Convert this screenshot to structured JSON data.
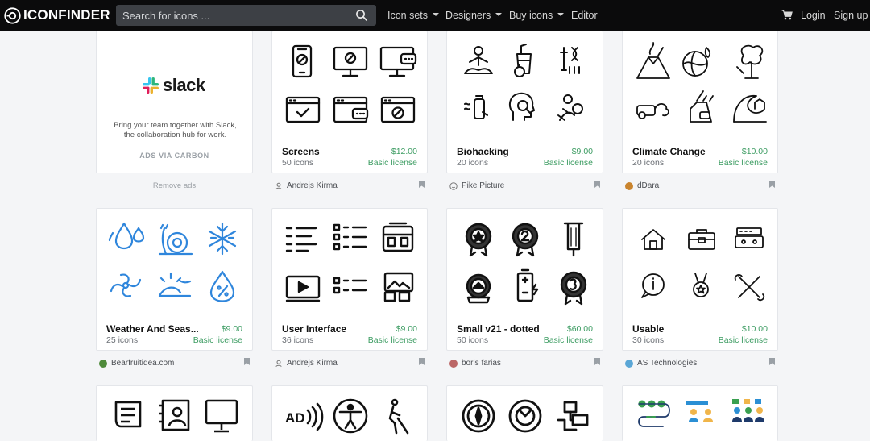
{
  "header": {
    "logo_text": "ICONFINDER",
    "search_placeholder": "Search for icons ...",
    "nav": {
      "icon_sets": "Icon sets",
      "designers": "Designers",
      "buy_icons": "Buy icons",
      "editor": "Editor",
      "login": "Login",
      "signup": "Sign up"
    }
  },
  "ad": {
    "brand": "slack",
    "text": "Bring your team together with Slack, the collaboration hub for work.",
    "via": "ADS VIA CARBON",
    "remove": "Remove ads"
  },
  "cards": [
    {
      "name": "Screens",
      "price": "$12.00",
      "count": "50 icons",
      "license": "Basic license",
      "author": "Andrejs Kirma"
    },
    {
      "name": "Biohacking",
      "price": "$9.00",
      "count": "20 icons",
      "license": "Basic license",
      "author": "Pike Picture"
    },
    {
      "name": "Climate Change",
      "price": "$10.00",
      "count": "20 icons",
      "license": "Basic license",
      "author": "dDara"
    },
    {
      "name": "Weather And Seas...",
      "price": "$9.00",
      "count": "25 icons",
      "license": "Basic license",
      "author": "Bearfruitidea.com"
    },
    {
      "name": "User Interface",
      "price": "$9.00",
      "count": "36 icons",
      "license": "Basic license",
      "author": "Andrejs Kirma"
    },
    {
      "name": "Small v21 - dotted",
      "price": "$60.00",
      "count": "50 icons",
      "license": "Basic license",
      "author": "boris farias"
    },
    {
      "name": "Usable",
      "price": "$10.00",
      "count": "30 icons",
      "license": "Basic license",
      "author": "AS Technologies"
    }
  ],
  "icons": {
    "brand": "iconfinder-logo-icon",
    "search": "search-icon",
    "cart": "cart-icon",
    "bookmark": "bookmark-icon",
    "author_avatar": "user-avatar-icon"
  },
  "colors": {
    "topbar": "#0b0b0c",
    "price_green": "#3c9c62",
    "weather_blue": "#2f86dc"
  }
}
